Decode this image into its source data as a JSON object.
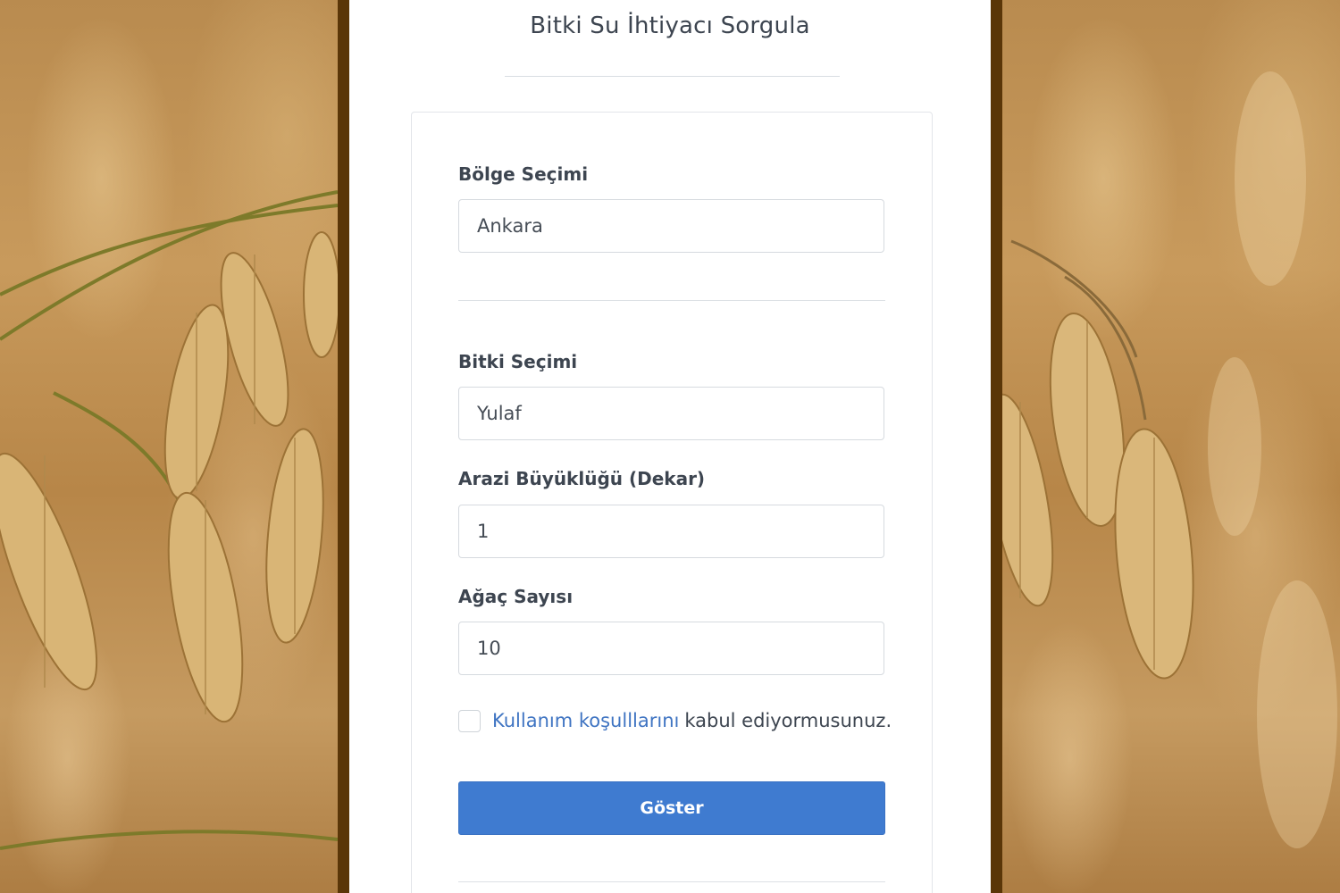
{
  "page": {
    "title": "Bitki Su İhtiyacı Sorgula"
  },
  "form": {
    "region": {
      "label": "Bölge Seçimi",
      "value": "Ankara"
    },
    "plant": {
      "label": "Bitki Seçimi",
      "value": "Yulaf"
    },
    "land_size": {
      "label": "Arazi Büyüklüğü (Dekar)",
      "value": "1"
    },
    "tree_count": {
      "label": "Ağaç Sayısı",
      "value": "10"
    },
    "terms": {
      "checked": false,
      "link_text": "Kullanım koşulllarını",
      "rest_text": "kabul ediyormusunuz."
    },
    "submit_label": "Göster"
  },
  "colors": {
    "accent": "#3f7bd0",
    "link": "#3f74c2",
    "frame": "#5a3608",
    "text": "#3d4550"
  },
  "icons": [
    "oat-photo-left",
    "oat-photo-right"
  ]
}
